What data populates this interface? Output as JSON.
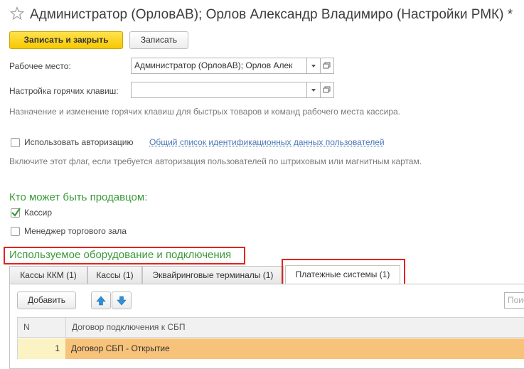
{
  "window": {
    "title": "Администратор (ОрловАВ); Орлов Александр Владимиро (Настройки РМК) *"
  },
  "toolbar": {
    "save_close_label": "Записать и закрыть",
    "save_label": "Записать"
  },
  "form": {
    "workplace_label": "Рабочее место:",
    "workplace_value": "Администратор (ОрловАВ); Орлов Алек",
    "hotkeys_label": "Настройка горячих клавиш:",
    "hotkeys_value": "",
    "hotkeys_hint": "Назначение и изменение горячих клавиш для быстрых товаров и команд рабочего места кассира.",
    "auth_label": "Использовать авторизацию",
    "auth_checked": false,
    "auth_link": "Общий список идентификационных данных пользователей",
    "auth_hint": "Включите этот флаг, если требуется авторизация пользователей по штриховым или магнитным картам."
  },
  "sellers": {
    "title": "Кто может быть продавцом:",
    "options": [
      {
        "label": "Кассир",
        "checked": true
      },
      {
        "label": "Менеджер торгового зала",
        "checked": false
      }
    ]
  },
  "equipment": {
    "title": "Используемое оборудование и подключения",
    "tabs": [
      {
        "label": "Кассы ККМ (1)",
        "active": false
      },
      {
        "label": "Кассы (1)",
        "active": false
      },
      {
        "label": "Эквайринговые терминалы (1)",
        "active": false
      },
      {
        "label": "Платежные системы (1)",
        "active": true
      }
    ],
    "add_label": "Добавить",
    "search_placeholder": "Поис",
    "columns": [
      "N",
      "Договор подключения к СБП"
    ],
    "rows": [
      {
        "n": "1",
        "contract": "Договор СБП - Открытие"
      }
    ]
  },
  "colors": {
    "accent_yellow": "#f7c800",
    "group_green": "#3a9a3a",
    "highlight_red": "#e0241c",
    "selected_row": "#f7c27a"
  }
}
